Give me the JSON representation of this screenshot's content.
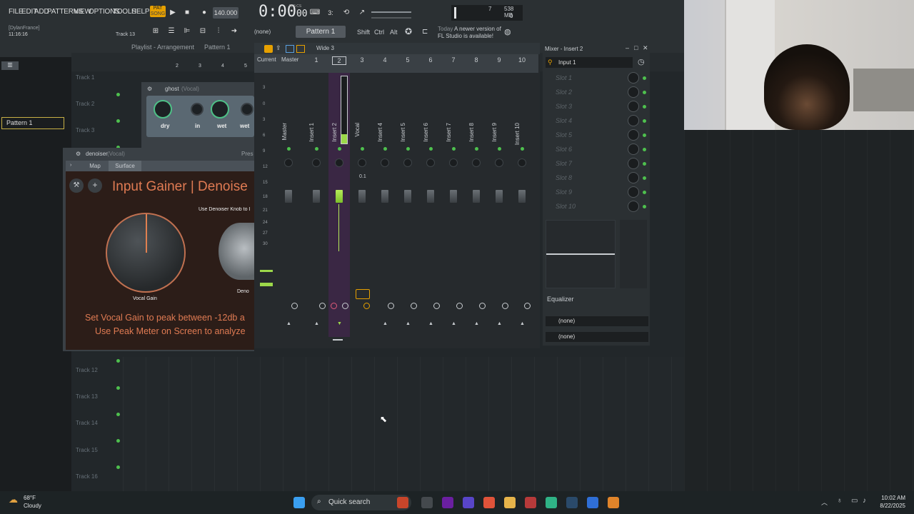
{
  "menu": [
    "FILE",
    "EDIT",
    "ADD",
    "PATTERNS",
    "VIEW",
    "OPTIONS",
    "TOOLS",
    "HELP"
  ],
  "toolbar": {
    "pat_label": "PAT",
    "song_label": "SONG",
    "bpm": "140.000",
    "time": "0:00",
    "time_small": "00",
    "time_label": "M:S:CS",
    "cpu_value": "7",
    "ram_value": "538 MB",
    "poly_value": "0",
    "pattern_button": "Pattern 1",
    "snap_value": "(none)",
    "shift_label": "Shift",
    "ctrl_label": "Ctrl",
    "alt_label": "Alt",
    "news_prefix": "Today",
    "news_text": "A newer version of",
    "news_text2": "FL Studio is available!"
  },
  "user": {
    "name": "[DylanFrance]",
    "time": "11:16:16",
    "hint_track": "Track 13"
  },
  "playlist": {
    "title": "Playlist - Arrangement",
    "pattern": "Pattern 1",
    "pattern_item": "Pattern 1",
    "tracks_top": [
      "Track 1",
      "Track 2",
      "Track 3"
    ],
    "tracks_bottom": [
      "Track 12",
      "Track 13",
      "Track 14",
      "Track 15",
      "Track 16"
    ],
    "bar_numbers": [
      "2",
      "3",
      "4",
      "5"
    ]
  },
  "ghost": {
    "title": "ghost",
    "subtitle": "(Vocal)",
    "knobs": [
      "dry",
      "in",
      "wet",
      "wet"
    ]
  },
  "denoiser": {
    "title": "denoiser",
    "subtitle": "(Vocal)",
    "preset_label": "Pres",
    "tab_map": "Map",
    "tab_surface": "Surface",
    "heading": "Input Gainer | Denoise",
    "hint": "Use Denoiser Knob to I",
    "knob_label": "Vocal Gain",
    "knob2_label": "Deno",
    "line1": "Set Vocal Gain to peak between -12db a",
    "line2": "Use Peak Meter on Screen to analyze"
  },
  "mixer": {
    "view_label": "Wide 3",
    "current": "Current",
    "master": "Master",
    "numbers": [
      "1",
      "2",
      "3",
      "4",
      "5",
      "6",
      "7",
      "8",
      "9",
      "10"
    ],
    "channel_names": [
      "Master",
      "Insert 1",
      "Insert 2",
      "Vocal",
      "Insert 4",
      "Insert 5",
      "Insert 6",
      "Insert 7",
      "Insert 8",
      "Insert 9",
      "Insert 10"
    ],
    "scale": [
      "3",
      "0",
      "3",
      "6",
      "9",
      "12",
      "15",
      "18",
      "21",
      "24",
      "27",
      "30"
    ],
    "pan_value": "0.1"
  },
  "insert_panel": {
    "title": "Mixer - Insert 2",
    "input": "Input 1",
    "slots": [
      "Slot 1",
      "Slot 2",
      "Slot 3",
      "Slot 4",
      "Slot 5",
      "Slot 6",
      "Slot 7",
      "Slot 8",
      "Slot 9",
      "Slot 10"
    ],
    "eq_label": "Equalizer",
    "route1": "(none)",
    "route2": "(none)"
  },
  "taskbar": {
    "weather_temp": "68°F",
    "weather_desc": "Cloudy",
    "search": "Quick search",
    "time": "10:02 AM",
    "date": "8/22/2025"
  },
  "colors": {
    "accent_green": "#4ec04e",
    "accent_orange": "#e6a000",
    "insert_purple": "#3a2744"
  }
}
